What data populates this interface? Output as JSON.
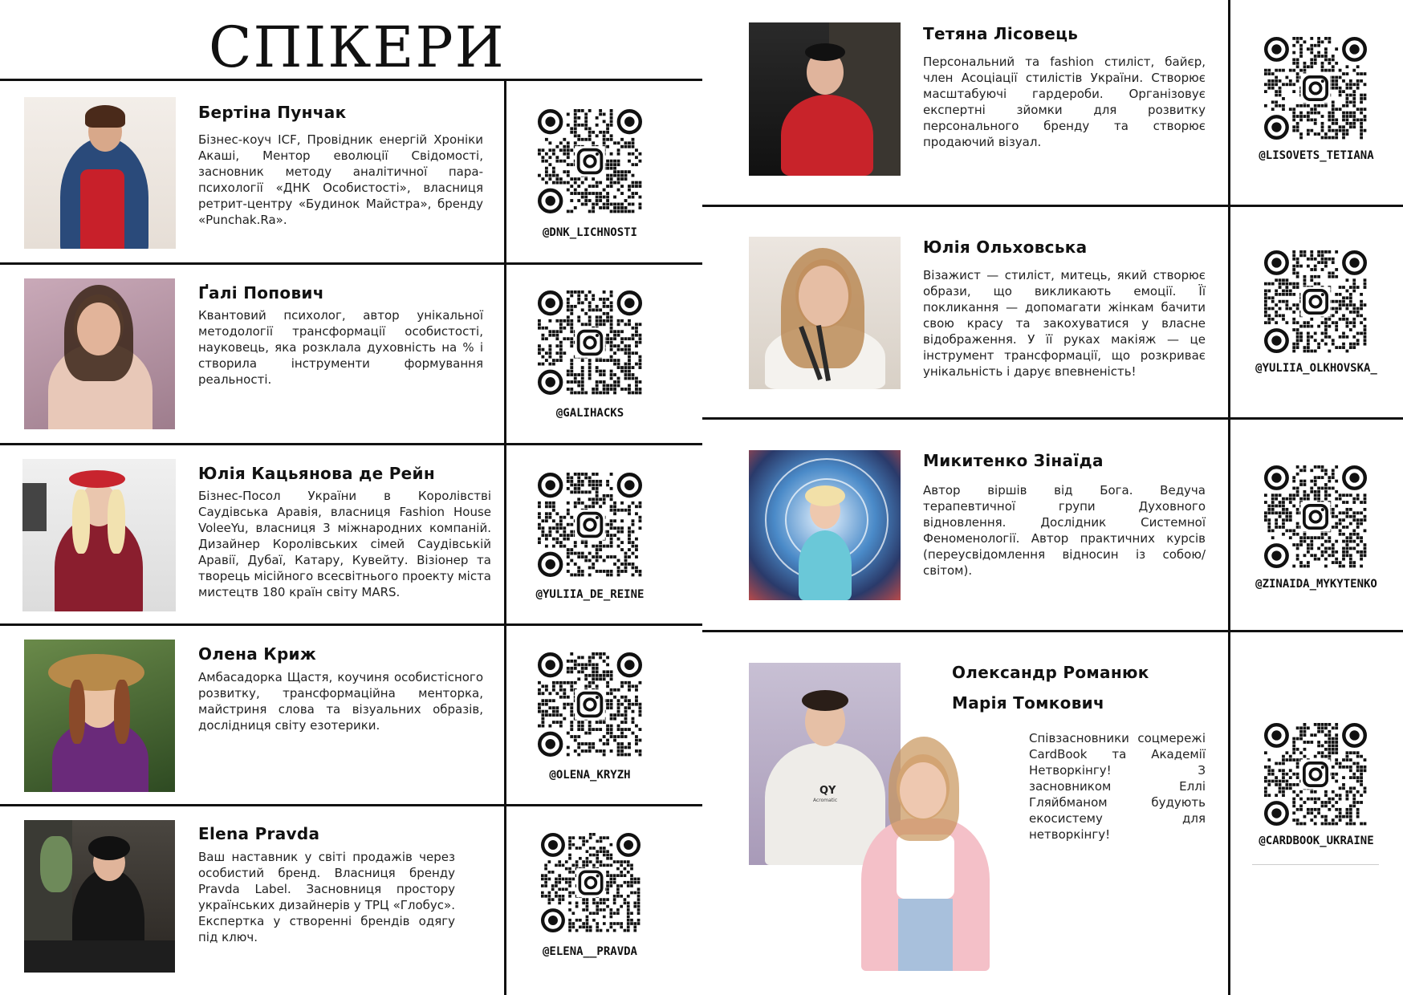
{
  "page": {
    "title": "СПІКЕРИ"
  },
  "left_speakers": [
    {
      "name": "Бертіна Пунчак",
      "description": "Бізнес-коуч ICF, Провідник енергій Хроніки Акаші, Ментор еволюції Свідомості, засновник методу аналітичної пара-психології «ДНК Особистості», власниця ретрит-центру «Будинок Майстра», бренду «Punchak.Ra».",
      "handle": "@DNK_LICHNOSTI"
    },
    {
      "name": "Ґалі Попович",
      "description": "Квантовий психолог, автор унікальної методології трансформації особистості, науковець, яка розклала духовність на % і створила інструменти формування реальності.",
      "handle": "@GALIHACKS"
    },
    {
      "name": "Юлія Кацьянова де Рейн",
      "description": "Бізнес-Посол України в Королівстві Саудівська Аравія, власниця Fashion House VoleeYu, власниця 3 міжнародних компаній. Дизайнер Королівських сімей Саудівській Аравії, Дубаї, Катару, Кувейту. Візіонер та творець місійного всесвітнього проекту міста мистецтв 180 країн світу MARS.",
      "handle": "@YULIIA_DE_REINE"
    },
    {
      "name": "Олена Криж",
      "description": "Амбасадорка Щастя, коучиня особистісного розвитку, трансформаційна менторка, майстриня слова та візуальних образів, дослідниця світу езотерики.",
      "handle": "@OLENA_KRYZH"
    },
    {
      "name": "Elena Pravda",
      "description": "Ваш наставник у світі продажів через особистий бренд. Власниця бренду Pravda Label. Засновниця простору українських дизайнерів у ТРЦ «Глобус». Експертка у створенні брендів одягу під ключ.",
      "handle": "@ELENA__PRAVDA"
    }
  ],
  "right_speakers": [
    {
      "name": "Тетяна Лісовець",
      "description": "Персональний та fashion стиліст, байєр, член Асоціації стилістів України. Створює масштабуючі гардероби. Організовує експертні зйомки для розвитку персонального бренду та створює продаючий візуал.",
      "handle": "@LISOVETS_TETIANA"
    },
    {
      "name": "Юлія Ольховська",
      "description": "Візажист — стиліст, митець, який створює образи, що викликають емоції. Її покликання — допомагати жінкам бачити свою красу та закохуватися у власне відображення. У її руках макіяж — це інструмент трансформації, що розкриває унікальність і дарує впевненість!",
      "handle": "@YULIIA_OLKHOVSKA_"
    },
    {
      "name": "Микитенко Зінаїда",
      "description": "Автор віршів від Бога. Ведуча терапевтичної групи Духовного відновлення. Дослідник Системної Феноменології. Автор практичних курсів (переусвідомлення відносин із собою/світом).",
      "handle": "@ZINAIDA_MYKYTENKO"
    }
  ],
  "duo": {
    "name_1": "Олександр Романюк",
    "name_2": "Марія Томкович",
    "description": "Співзасновники соцмережі CardBook та Академії Нетворкінгу! З засновником Еллі Гляйбманом будують екосистему для нетворкінгу!",
    "handle": "@CARDBOOK_UKRAINE",
    "shirt_text": "QY",
    "shirt_subtext": "Acromatic"
  },
  "colors": {
    "line": "#111111",
    "text": "#222222",
    "background": "#ffffff"
  }
}
